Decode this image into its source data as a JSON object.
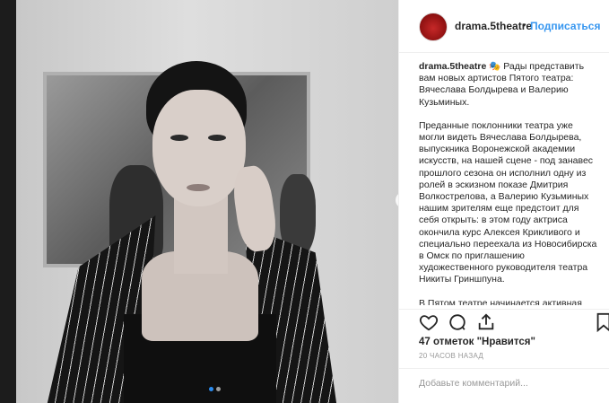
{
  "post": {
    "username": "drama.5theatre",
    "separator": "•",
    "follow_label": "Подписаться",
    "avatar_color": "#c62828",
    "accent_color": "#3897f0"
  },
  "photo": {
    "next_icon": "chevron-right-icon",
    "carousel_dots": 2,
    "active_dot": 1
  },
  "caption": {
    "username": "drama.5theatre",
    "paragraphs": [
      "🎭 Рады представить вам новых артистов Пятого театра: Вячеслава Болдырева и Валерию Кузьминых.",
      "Преданные поклонники театра уже могли видеть Вячеслава Болдырева, выпускника Воронежской академии искусств, на нашей сцене - под занавес прошлого сезона он исполнил одну из ролей в эскизном показе Дмитрия Волкострелова, а Валерию Кузьминых нашим зрителям еще предстоит для себя открыть: в этом году актриса окончила курс Алексея Крикливого и специально переехала из Новосибирска в Омск по приглашению художественного руководителя театра Никиты Гриншпуна.",
      "В Пятом театре начинается активная"
    ]
  },
  "actions": {
    "icons": [
      "heart-icon",
      "comment-icon",
      "share-icon",
      "bookmark-icon"
    ]
  },
  "likes_text": "47 отметок \"Нравится\"",
  "timestamp": "20 ЧАСОВ НАЗАД",
  "comment": {
    "placeholder": "Добавьте комментарий...",
    "value": ""
  }
}
